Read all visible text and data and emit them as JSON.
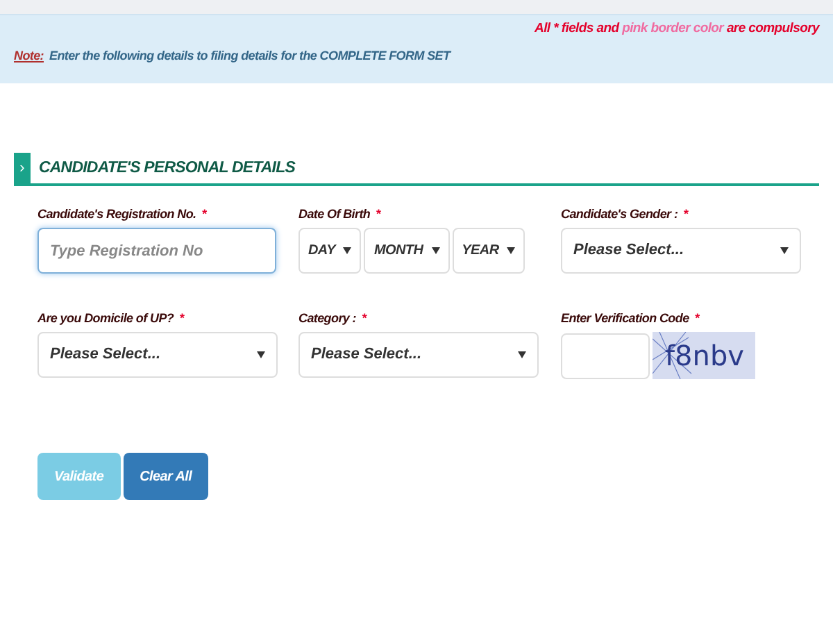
{
  "notice": {
    "prefix": "All",
    "star": "*",
    "middle": "fields and",
    "pink": "pink border color",
    "suffix": "are compulsory"
  },
  "note": {
    "label": "Note:",
    "text": "Enter the following details to filing details for the COMPLETE FORM SET"
  },
  "section": {
    "toggle": "›",
    "title": "CANDIDATE'S PERSONAL DETAILS"
  },
  "fields": [
    {
      "kind": "text",
      "label": "Candidate's Registration No.",
      "required": true,
      "placeholder": "Type Registration No",
      "focused": true
    },
    {
      "kind": "date",
      "label": "Date Of Birth",
      "required": true,
      "parts": [
        "DAY",
        "MONTH",
        "YEAR"
      ]
    },
    {
      "kind": "select",
      "label": "Candidate's Gender :",
      "required": true,
      "value": "Please Select..."
    },
    {
      "kind": "select",
      "label": "Are you Domicile of UP?",
      "required": true,
      "value": "Please Select..."
    },
    {
      "kind": "select",
      "label": "Category :",
      "required": true,
      "value": "Please Select..."
    },
    {
      "kind": "captcha",
      "label": "Enter Verification Code",
      "required": true,
      "code": "f8nbv"
    }
  ],
  "buttons": [
    {
      "label": "Validate",
      "disabled": true
    },
    {
      "label": "Clear All",
      "disabled": false
    }
  ]
}
